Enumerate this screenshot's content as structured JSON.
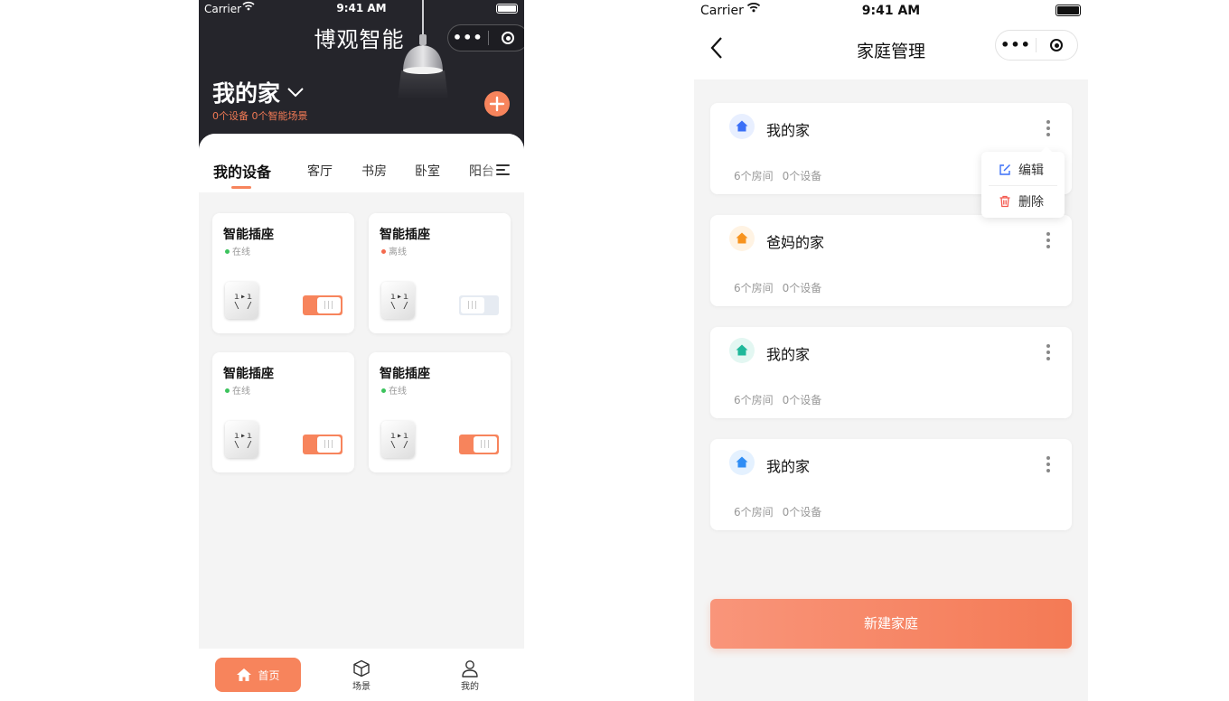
{
  "status_bar": {
    "carrier": "Carrier",
    "time": "9:41 AM"
  },
  "screen1": {
    "brand": "博观智能",
    "home_name": "我的家",
    "home_summary": "0个设备 0个智能场景",
    "tabs": [
      "我的设备",
      "客厅",
      "书房",
      "卧室",
      "阳台"
    ],
    "devices": [
      {
        "name": "智能插座",
        "status": "在线",
        "online": true,
        "switch_on": true
      },
      {
        "name": "智能插座",
        "status": "离线",
        "online": false,
        "switch_on": false
      },
      {
        "name": "智能插座",
        "status": "在线",
        "online": true,
        "switch_on": true
      },
      {
        "name": "智能插座",
        "status": "在线",
        "online": true,
        "switch_on": true
      }
    ],
    "tabbar": [
      {
        "label": "首页",
        "icon": "home-icon",
        "active": true
      },
      {
        "label": "场景",
        "icon": "cube-icon",
        "active": false
      },
      {
        "label": "我的",
        "icon": "user-icon",
        "active": false
      }
    ]
  },
  "screen2": {
    "title": "家庭管理",
    "homes": [
      {
        "name": "我的家",
        "rooms": "6个房间",
        "devices": "0个设备",
        "icon_color": "#3a6ff7",
        "icon_bg": "#e8efff"
      },
      {
        "name": "爸妈的家",
        "rooms": "6个房间",
        "devices": "0个设备",
        "icon_color": "#f7931e",
        "icon_bg": "#fff3e3"
      },
      {
        "name": "我的家",
        "rooms": "6个房间",
        "devices": "0个设备",
        "icon_color": "#1fb89a",
        "icon_bg": "#e3f7f2"
      },
      {
        "name": "我的家",
        "rooms": "6个房间",
        "devices": "0个设备",
        "icon_color": "#2f8df5",
        "icon_bg": "#e4f1ff"
      }
    ],
    "popover": {
      "edit_label": "编辑",
      "delete_label": "删除"
    },
    "new_home_button": "新建家庭"
  },
  "colors": {
    "accent": "#f7845c",
    "header_dark": "#25252b",
    "online": "#3cc35d",
    "offline": "#f46a4e",
    "edit_icon": "#3a6ff7",
    "delete_icon": "#f4584e"
  }
}
